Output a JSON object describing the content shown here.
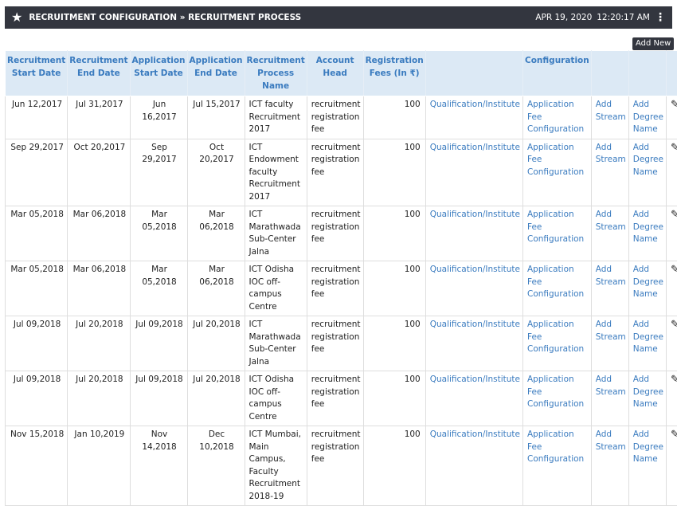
{
  "header": {
    "title": "RECRUITMENT CONFIGURATION » RECRUITMENT PROCESS",
    "date": "APR 19, 2020",
    "time": "12:20:17 AM",
    "star_icon": "star-icon",
    "menu_icon": "kebab-menu-icon"
  },
  "add_new_label": "Add New",
  "table": {
    "headers": [
      "Recruitment Start Date",
      "Recruitment End Date",
      "Application Start Date",
      "Application End Date",
      "Recruitment Process Name",
      "Account Head",
      "Registration Fees (In ₹)",
      "",
      "Configuration",
      "",
      "",
      "",
      ""
    ],
    "rows": [
      {
        "rstart": "Jun 12,2017",
        "rend": "Jul 31,2017",
        "astart": "Jun 16,2017",
        "aend": "Jul 15,2017",
        "name": "ICT faculty Recruitment 2017",
        "head": "recruitment registration fee",
        "fee": "100",
        "qual": "Qualification/Institute",
        "appfee": "Application Fee Configuration",
        "stream": "Add Stream",
        "degree": "Add Degree Name"
      },
      {
        "rstart": "Sep 29,2017",
        "rend": "Oct 20,2017",
        "astart": "Sep 29,2017",
        "aend": "Oct 20,2017",
        "name": "ICT Endowment faculty Recruitment 2017",
        "head": "recruitment registration fee",
        "fee": "100",
        "qual": "Qualification/Institute",
        "appfee": "Application Fee Configuration",
        "stream": "Add Stream",
        "degree": "Add Degree Name"
      },
      {
        "rstart": "Mar 05,2018",
        "rend": "Mar 06,2018",
        "astart": "Mar 05,2018",
        "aend": "Mar 06,2018",
        "name": "ICT Marathwada Sub-Center Jalna",
        "head": "recruitment registration fee",
        "fee": "100",
        "qual": "Qualification/Institute",
        "appfee": "Application Fee Configuration",
        "stream": "Add Stream",
        "degree": "Add Degree Name"
      },
      {
        "rstart": "Mar 05,2018",
        "rend": "Mar 06,2018",
        "astart": "Mar 05,2018",
        "aend": "Mar 06,2018",
        "name": "ICT Odisha IOC off-campus Centre",
        "head": "recruitment registration fee",
        "fee": "100",
        "qual": "Qualification/Institute",
        "appfee": "Application Fee Configuration",
        "stream": "Add Stream",
        "degree": "Add Degree Name"
      },
      {
        "rstart": "Jul 09,2018",
        "rend": "Jul 20,2018",
        "astart": "Jul 09,2018",
        "aend": "Jul 20,2018",
        "name": "ICT Marathwada Sub-Center Jalna",
        "head": "recruitment registration fee",
        "fee": "100",
        "qual": "Qualification/Institute",
        "appfee": "Application Fee Configuration",
        "stream": "Add Stream",
        "degree": "Add Degree Name"
      },
      {
        "rstart": "Jul 09,2018",
        "rend": "Jul 20,2018",
        "astart": "Jul 09,2018",
        "aend": "Jul 20,2018",
        "name": "ICT Odisha IOC off-campus Centre",
        "head": "recruitment registration fee",
        "fee": "100",
        "qual": "Qualification/Institute",
        "appfee": "Application Fee Configuration",
        "stream": "Add Stream",
        "degree": "Add Degree Name"
      },
      {
        "rstart": "Nov 15,2018",
        "rend": "Jan 10,2019",
        "astart": "Nov 14,2018",
        "aend": "Dec 10,2018",
        "name": "ICT Mumbai, Main Campus, Faculty Recruitment 2018-19",
        "head": "recruitment registration fee",
        "fee": "100",
        "qual": "Qualification/Institute",
        "appfee": "Application Fee Configuration",
        "stream": "Add Stream",
        "degree": "Add Degree Name"
      }
    ],
    "edit_icon": "pencil-edit-icon"
  }
}
